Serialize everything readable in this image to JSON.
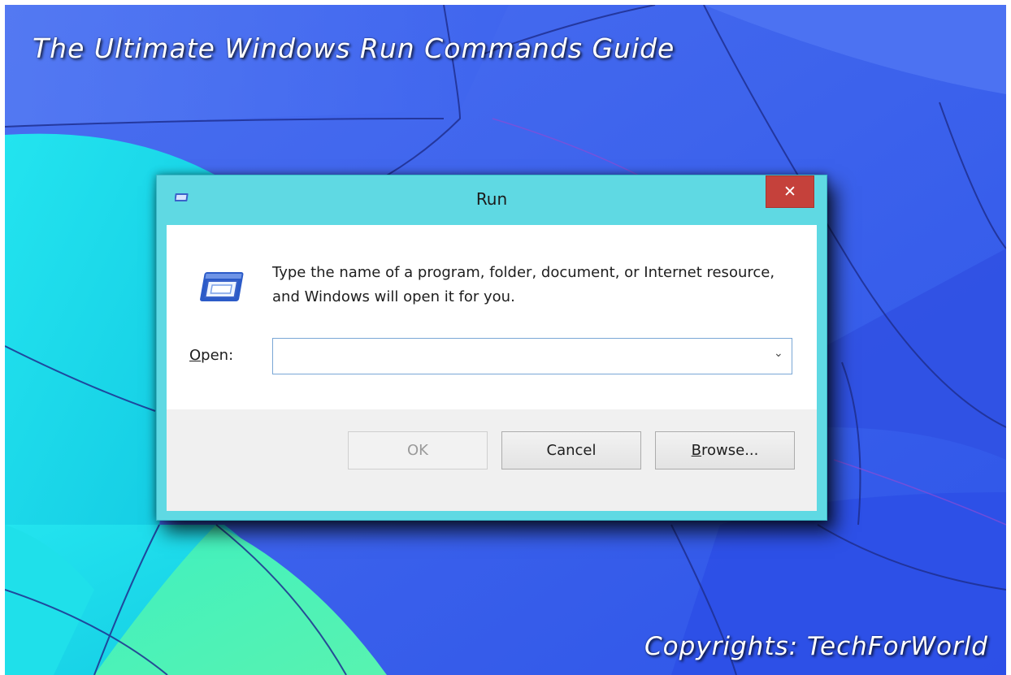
{
  "wallpaper": {
    "headline": "The Ultimate Windows Run Commands Guide",
    "copyright": "Copyrights: TechForWorld",
    "colors": {
      "base": "#3f67ee",
      "teal": "#1fd9e8",
      "green": "#4ef0b8",
      "line": "#1f2f90"
    }
  },
  "dialog": {
    "title": "Run",
    "title_icon": "run-window-icon",
    "close_glyph": "✕",
    "description": "Type the name of a program, folder, document, or Internet resource, and Windows will open it for you.",
    "open_label": "Open:",
    "open_label_accesskey": "O",
    "open_value": "",
    "dropdown_glyph": "⌄",
    "buttons": {
      "ok": "OK",
      "cancel": "Cancel",
      "browse": "Browse..."
    },
    "colors": {
      "frame": "#5fd9e3",
      "close": "#c5413b"
    }
  }
}
